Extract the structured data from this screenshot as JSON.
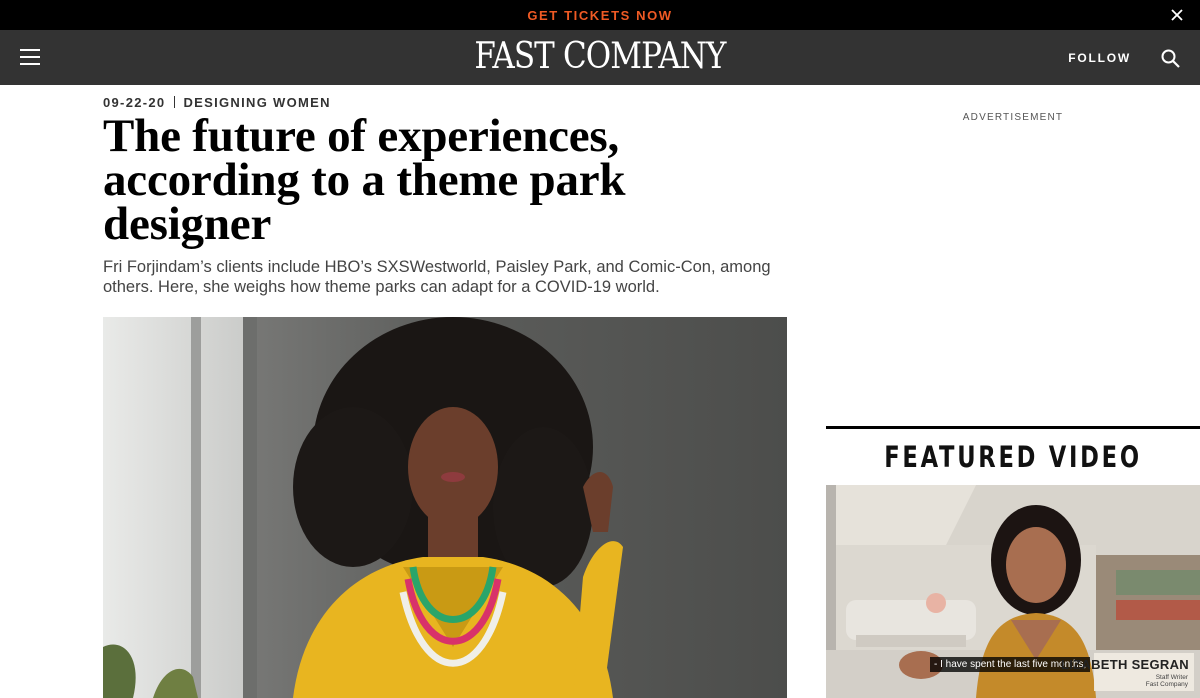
{
  "promo": {
    "text": "GET TICKETS NOW",
    "close_icon": "close-icon"
  },
  "header": {
    "logo": "FAST COMPANY",
    "follow": "FOLLOW",
    "menu_icon": "menu-icon",
    "search_icon": "search-icon"
  },
  "article": {
    "date": "09-22-20",
    "category": "DESIGNING WOMEN",
    "headline": "The future of experiences, according to a theme park designer",
    "dek": "Fri Forjindam’s clients include HBO’s SXSWestworld, Paisley Park, and Comic-Con, among others. Here, she weighs how theme parks can adapt for a COVID-19 world."
  },
  "sidebar": {
    "ad_label": "ADVERTISEMENT",
    "featured_video": {
      "title": "FEATURED VIDEO",
      "caption": "- I have spent the last five months,",
      "name": "LIZABETH SEGRAN",
      "role": [
        "Staff Writer",
        "Fast Company"
      ]
    }
  },
  "colors": {
    "promo_text": "#ef5a24",
    "header_bg": "#333333",
    "jacket": "#e8b520"
  }
}
